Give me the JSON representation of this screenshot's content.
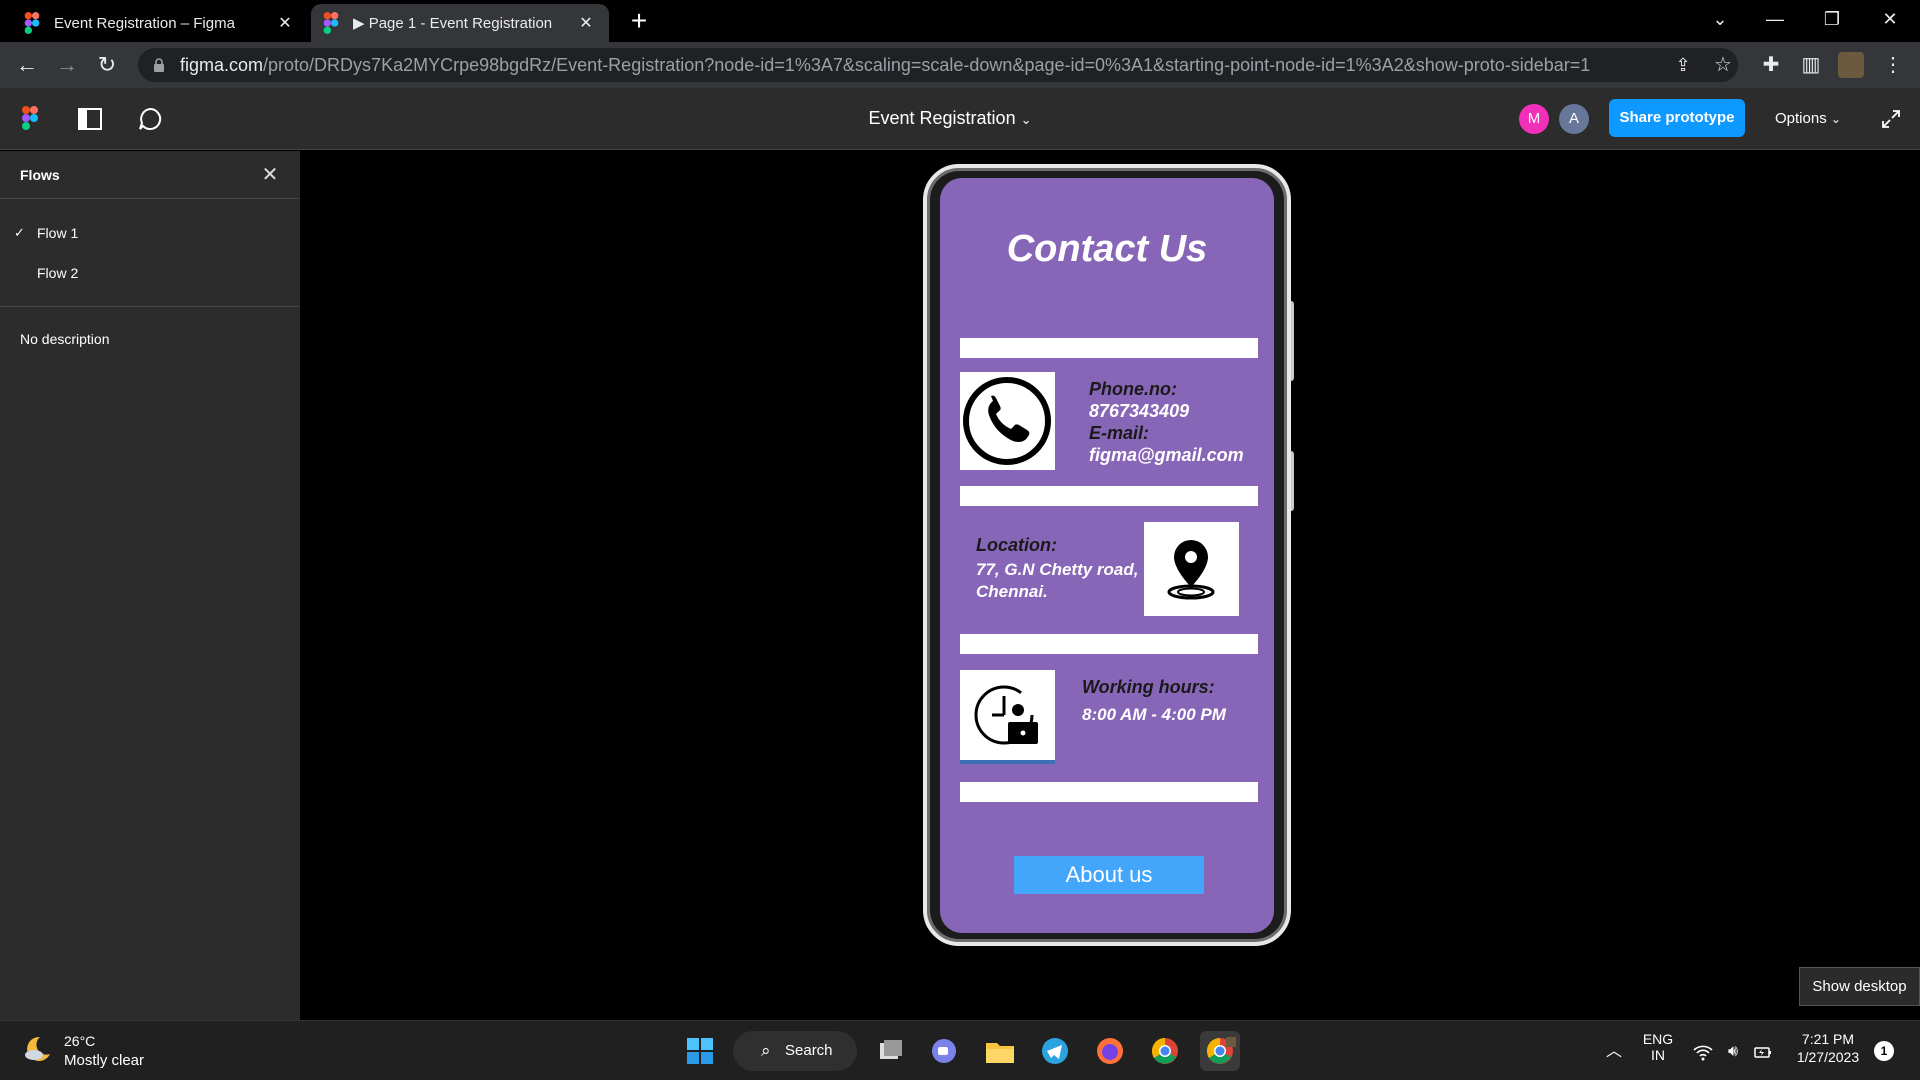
{
  "browser": {
    "tabs": [
      {
        "title": "Event Registration – Figma",
        "active": false
      },
      {
        "title": "▶ Page 1 - Event Registration",
        "active": true
      }
    ],
    "url_host": "figma.com",
    "url_path": "/proto/DRDys7Ka2MYCrpe98bgdRz/Event-Registration?node-id=1%3A7&scaling=scale-down&page-id=0%3A1&starting-point-node-id=1%3A2&show-proto-sidebar=1"
  },
  "figma": {
    "file_title": "Event Registration",
    "avatars": [
      {
        "initial": "M",
        "color": "#f22fb8"
      },
      {
        "initial": "A",
        "color": "#667799"
      }
    ],
    "share_label": "Share prototype",
    "options_label": "Options"
  },
  "sidebar": {
    "title": "Flows",
    "flows": [
      {
        "label": "Flow 1",
        "selected": true
      },
      {
        "label": "Flow 2",
        "selected": false
      }
    ],
    "description": "No description"
  },
  "prototype": {
    "title": "Contact Us",
    "phone_label": "Phone.no:",
    "phone_value": "8767343409",
    "email_label": "E-mail:",
    "email_value": "figma@gmail.com",
    "location_label": "Location:",
    "location_line1": "77, G.N Chetty road,",
    "location_line2": "Chennai.",
    "hours_label": "Working hours:",
    "hours_value": "8:00 AM - 4:00 PM",
    "about_button": "About us",
    "screen_color": "#8866b7",
    "button_color": "#44a6fa"
  },
  "show_desktop": "Show desktop",
  "taskbar": {
    "weather_temp": "26°C",
    "weather_desc": "Mostly clear",
    "search_label": "Search",
    "lang_top": "ENG",
    "lang_bottom": "IN",
    "time": "7:21 PM",
    "date": "1/27/2023",
    "notification_count": "1"
  }
}
